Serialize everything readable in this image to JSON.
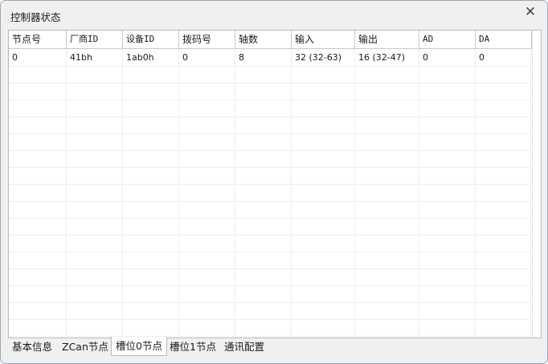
{
  "window": {
    "title": "控制器状态",
    "close_glyph": "✕"
  },
  "table": {
    "columns": [
      "节点号",
      "厂商ID",
      "设备ID",
      "拨码号",
      "轴数",
      "输入",
      "输出",
      "AD",
      "DA"
    ],
    "rows": [
      [
        "0",
        "41bh",
        "1ab0h",
        "0",
        "8",
        "32 (32-63)",
        "16 (32-47)",
        "0",
        "0"
      ]
    ]
  },
  "tabs": [
    {
      "label": "基本信息",
      "active": false
    },
    {
      "label": "ZCan节点",
      "active": false
    },
    {
      "label": "槽位0节点",
      "active": true
    },
    {
      "label": "槽位1节点",
      "active": false
    },
    {
      "label": "通讯配置",
      "active": false
    }
  ]
}
